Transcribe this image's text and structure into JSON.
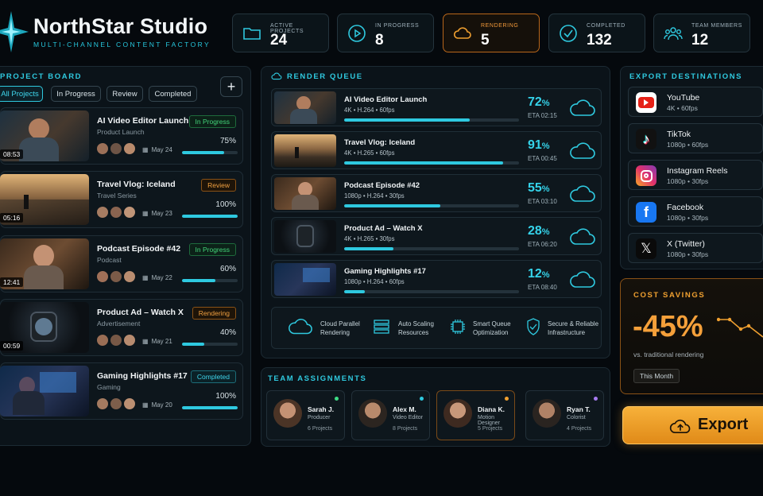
{
  "app": {
    "title": "NorthStar Studio",
    "subtitle": "MULTI-CHANNEL CONTENT FACTORY"
  },
  "stats": [
    {
      "label": "ACTIVE PROJECTS",
      "value": "24",
      "icon": "folder-icon"
    },
    {
      "label": "IN PROGRESS",
      "value": "8",
      "icon": "play-icon"
    },
    {
      "label": "RENDERING",
      "value": "5",
      "icon": "cloud-icon"
    },
    {
      "label": "COMPLETED",
      "value": "132",
      "icon": "check-circle-icon"
    },
    {
      "label": "TEAM MEMBERS",
      "value": "12",
      "icon": "team-icon"
    }
  ],
  "board": {
    "title": "PROJECT BOARD",
    "add_label": "+",
    "filters": [
      "All Projects",
      "In Progress",
      "Review",
      "Completed"
    ],
    "projects": [
      {
        "title": "AI Video Editor Launch",
        "category": "Product Launch",
        "status": "In Progress",
        "date": "May 24",
        "percent_label": "75%",
        "progress": 0.75,
        "duration": "08:53"
      },
      {
        "title": "Travel Vlog: Iceland",
        "category": "Travel Series",
        "status": "Review",
        "date": "May 23",
        "percent_label": "100%",
        "progress": 1.0,
        "duration": "05:16"
      },
      {
        "title": "Podcast Episode #42",
        "category": "Podcast",
        "status": "In Progress",
        "date": "May 22",
        "percent_label": "60%",
        "progress": 0.6,
        "duration": "12:41"
      },
      {
        "title": "Product Ad – Watch X",
        "category": "Advertisement",
        "status": "Rendering",
        "date": "May 21",
        "percent_label": "40%",
        "progress": 0.4,
        "duration": "00:59"
      },
      {
        "title": "Gaming Highlights #17",
        "category": "Gaming",
        "status": "Completed",
        "date": "May 20",
        "percent_label": "100%",
        "progress": 1.0,
        "duration": ""
      }
    ]
  },
  "queue": {
    "title": "RENDER QUEUE",
    "items": [
      {
        "title": "AI Video Editor Launch",
        "meta": "4K  •  H.264  •  60fps",
        "percent": "72",
        "eta": "ETA 02:15",
        "progress": 0.72
      },
      {
        "title": "Travel Vlog: Iceland",
        "meta": "4K  •  H.265  •  60fps",
        "percent": "91",
        "eta": "ETA 00:45",
        "progress": 0.91
      },
      {
        "title": "Podcast Episode #42",
        "meta": "1080p  •  H.264  •  30fps",
        "percent": "55",
        "eta": "ETA 03:10",
        "progress": 0.55
      },
      {
        "title": "Product Ad – Watch X",
        "meta": "4K  •  H.265  •  30fps",
        "percent": "28",
        "eta": "ETA 06:20",
        "progress": 0.28
      },
      {
        "title": "Gaming Highlights #17",
        "meta": "1080p  •  H.264  •  60fps",
        "percent": "12",
        "eta": "ETA 08:40",
        "progress": 0.12
      }
    ],
    "features": [
      {
        "line1": "Cloud Parallel",
        "line2": "Rendering"
      },
      {
        "line1": "Auto Scaling",
        "line2": "Resources"
      },
      {
        "line1": "Smart Queue",
        "line2": "Optimization"
      },
      {
        "line1": "Secure & Reliable",
        "line2": "Infrastructure"
      }
    ]
  },
  "team": {
    "title": "TEAM ASSIGNMENTS",
    "members": [
      {
        "name": "Sarah J.",
        "role": "Producer",
        "projects": "6 Projects",
        "dot": "#3ddc84"
      },
      {
        "name": "Alex M.",
        "role": "Video Editor",
        "projects": "8 Projects",
        "dot": "#2fc9df"
      },
      {
        "name": "Diana K.",
        "role": "Motion Designer",
        "projects": "5 Projects",
        "dot": "#f0a030"
      },
      {
        "name": "Ryan T.",
        "role": "Colorist",
        "projects": "4 Projects",
        "dot": "#a77bf0"
      }
    ]
  },
  "export": {
    "title": "EXPORT DESTINATIONS",
    "destinations": [
      {
        "name": "YouTube",
        "meta": "4K  •  60fps",
        "icon": "youtube-icon"
      },
      {
        "name": "TikTok",
        "meta": "1080p  •  60fps",
        "icon": "tiktok-icon"
      },
      {
        "name": "Instagram Reels",
        "meta": "1080p  •  30fps",
        "icon": "instagram-icon"
      },
      {
        "name": "Facebook",
        "meta": "1080p  •  30fps",
        "icon": "facebook-icon"
      },
      {
        "name": "X (Twitter)",
        "meta": "1080p  •  30fps",
        "icon": "x-icon"
      }
    ],
    "button_label": "Export"
  },
  "savings": {
    "title": "COST SAVINGS",
    "value": "-45%",
    "note": "vs. traditional rendering",
    "period": "This Month"
  },
  "colors": {
    "accent": "#2fc9df",
    "orange": "#f0a030",
    "bg": "#05090d"
  }
}
